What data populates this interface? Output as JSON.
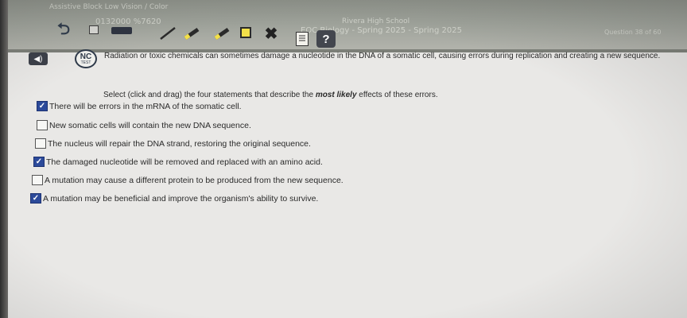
{
  "header": {
    "top_left_text": "Assistive Block Low Vision / Color",
    "student_id": "0132000 %7620",
    "school_name": "Rivera High School",
    "test_title": "EOC Biology - Spring 2025 - Spring 2025",
    "question_counter": "Question 38 of 60"
  },
  "toolbar": {
    "back_label": "⮌",
    "close_label": "✖",
    "help_label": "?",
    "speaker_label": "◀)"
  },
  "logo": {
    "nc": "NC",
    "test": "TEST"
  },
  "question": {
    "text": "Radiation or toxic chemicals can sometimes damage a nucleotide in the DNA of a somatic cell, causing errors during replication and creating a new sequence.",
    "instruction_prefix": "Select (click and drag) the four statements that describe the ",
    "instruction_emphasis": "most likely",
    "instruction_suffix": " effects of these errors."
  },
  "options": [
    {
      "text": "There will be errors in the mRNA of the somatic cell.",
      "checked": true
    },
    {
      "text": "New somatic cells will contain the new DNA sequence.",
      "checked": false
    },
    {
      "text": "The nucleus will repair the DNA strand, restoring the original sequence.",
      "checked": false
    },
    {
      "text": "The damaged nucleotide will be removed and replaced with an amino acid.",
      "checked": true
    },
    {
      "text": "A mutation may cause a different protein to be produced from the new sequence.",
      "checked": false
    },
    {
      "text": "A mutation may be beneficial and improve the organism's ability to survive.",
      "checked": true
    }
  ],
  "colors": {
    "checkbox_checked": "#2c4a9a",
    "header_band": "#9ea29a",
    "highlighter_yellow": "#f3e04a"
  }
}
